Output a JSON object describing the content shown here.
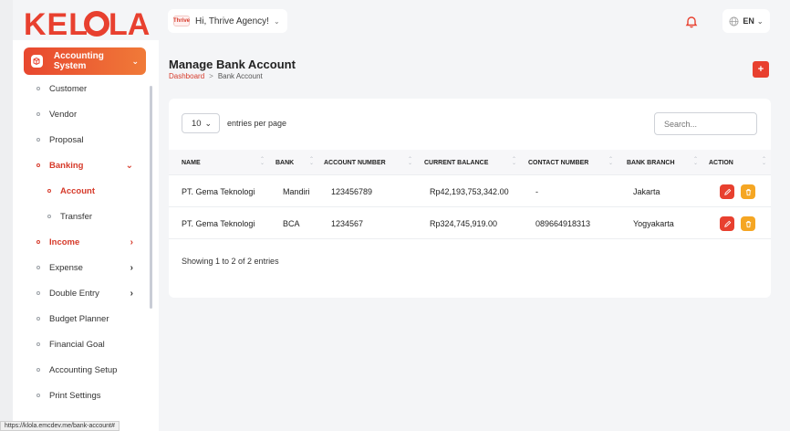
{
  "brand": {
    "logo_text": "KELOLA",
    "accent": "#e8402f",
    "accent2": "#f5a623"
  },
  "topbar": {
    "greeting": "Hi, Thrive Agency!",
    "avatar_text": "Thrive",
    "language": "EN"
  },
  "sidebar": {
    "system_label": "Accounting System",
    "items": [
      {
        "label": "Customer"
      },
      {
        "label": "Vendor"
      },
      {
        "label": "Proposal"
      },
      {
        "label": "Banking"
      },
      {
        "label": "Account"
      },
      {
        "label": "Transfer"
      },
      {
        "label": "Income"
      },
      {
        "label": "Expense"
      },
      {
        "label": "Double Entry"
      },
      {
        "label": "Budget Planner"
      },
      {
        "label": "Financial Goal"
      },
      {
        "label": "Accounting Setup"
      },
      {
        "label": "Print Settings"
      }
    ]
  },
  "page": {
    "title": "Manage Bank Account",
    "breadcrumb": {
      "home": "Dashboard",
      "sep": ">",
      "current": "Bank Account"
    },
    "add_label": "+"
  },
  "table": {
    "entries_value": "10",
    "entries_label": "entries per page",
    "search_placeholder": "Search...",
    "headers": [
      "NAME",
      "BANK",
      "ACCOUNT NUMBER",
      "CURRENT BALANCE",
      "CONTACT NUMBER",
      "BANK BRANCH",
      "ACTION"
    ],
    "rows": [
      [
        "PT. Gema Teknologi",
        "Mandiri",
        "123456789",
        "Rp42,193,753,342.00",
        "-",
        "Jakarta"
      ],
      [
        "PT. Gema Teknologi",
        "BCA",
        "1234567",
        "Rp324,745,919.00",
        "089664918313",
        "Yogyakarta"
      ]
    ],
    "footer": "Showing 1 to 2 of 2 entries"
  },
  "statusbar": {
    "url": "https://klola.emcdev.me/bank-account#"
  }
}
